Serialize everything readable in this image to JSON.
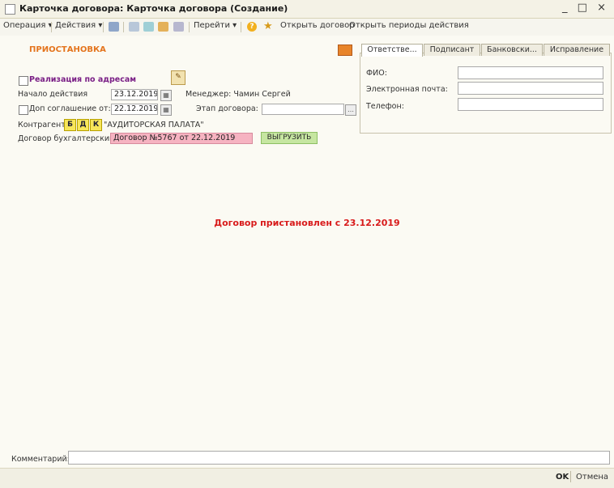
{
  "window": {
    "title": "Карточка договора: Карточка договора (Создание)",
    "controls": "_ □ ×"
  },
  "toolbar": {
    "operation": "Операция ▾",
    "actions": "Действия ▾",
    "goto": "Перейти ▾",
    "open_contract": "Открыть договор",
    "open_periods": "Открыть периоды действия"
  },
  "form": {
    "section_title": "ПРИОСТАНОВКА",
    "addresses_label": "Реализация по адресам",
    "start_label": "Начало действия",
    "start_value": "23.12.2019",
    "manager_text": "Менеджер: Чамин Сергей",
    "supplement_label": "Доп соглашение  от:",
    "supplement_date": "22.12.2019",
    "stage_label": "Этап договора:",
    "stage_value": "",
    "counterparty_label": "Контрагент:",
    "counterparty_buttons": [
      "Б",
      "Д",
      "К"
    ],
    "counterparty_value": "\"АУДИТОРСКАЯ ПАЛАТА\"",
    "contract_label": "Договор бухгалтерский:",
    "contract_value": "Договор №5767 от 22.12.2019",
    "upload_button": "ВЫГРУЗИТЬ"
  },
  "tabs": [
    "Ответстве...",
    "Подписант",
    "Банковски...",
    "Исправление"
  ],
  "panel": {
    "fio_label": "ФИО:",
    "email_label": "Электронная почта:",
    "phone_label": "Телефон:",
    "fio_value": "",
    "email_value": "",
    "phone_value": ""
  },
  "status_message": "Договор пристановлен с 23.12.2019",
  "footer": {
    "comment_label": "Комментарий:",
    "comment_value": "",
    "ok_button": "OK",
    "cancel_button": "Отмена"
  }
}
